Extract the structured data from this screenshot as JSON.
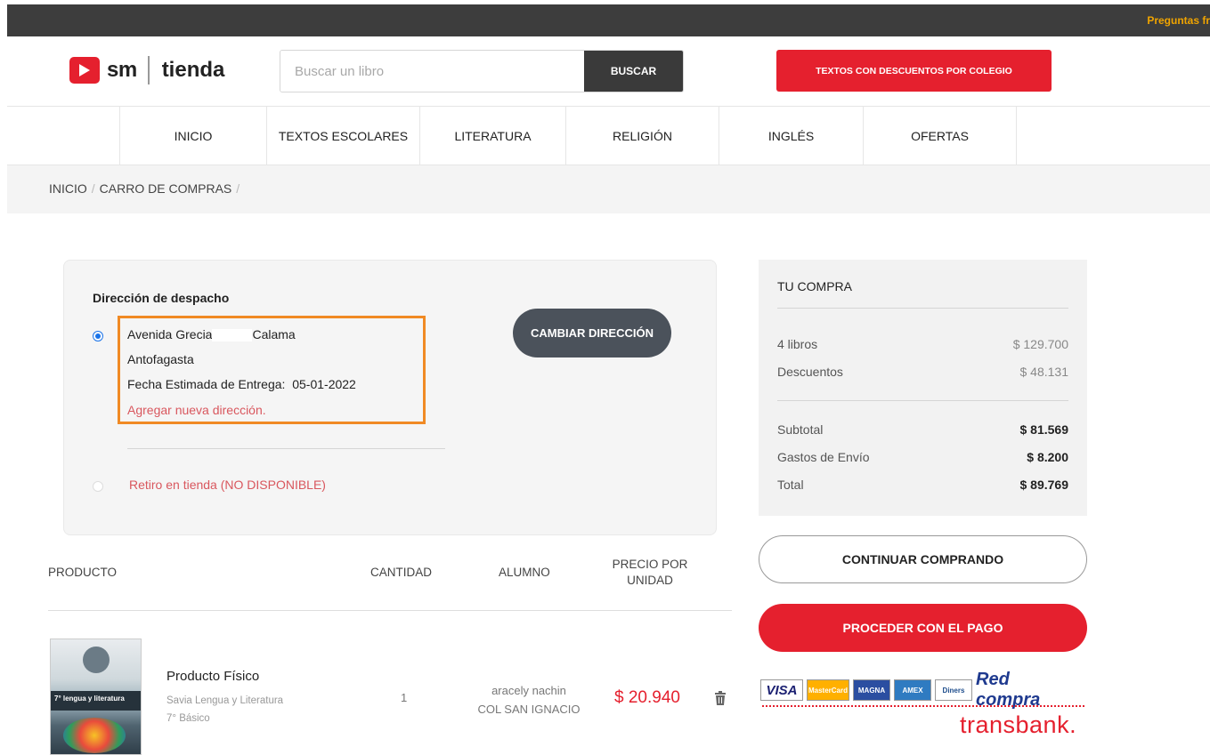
{
  "topbar": {
    "faq_text": "Preguntas fr"
  },
  "header": {
    "logo_sm": "sm",
    "logo_tienda": "tienda",
    "search_placeholder": "Buscar un libro",
    "search_button": "BUSCAR",
    "promo_button": "TEXTOS CON DESCUENTOS POR COLEGIO"
  },
  "nav": {
    "items": [
      "INICIO",
      "TEXTOS ESCOLARES",
      "LITERATURA",
      "RELIGIÓN",
      "INGLÉS",
      "OFERTAS"
    ]
  },
  "breadcrumb": [
    "INICIO",
    "CARRO DE COMPRAS"
  ],
  "shipping": {
    "title": "Dirección de despacho",
    "address_street": "Avenida Grecia",
    "address_city": "Calama",
    "address_region": "Antofagasta",
    "delivery_label": "Fecha Estimada de Entrega:",
    "delivery_date": "05-01-2022",
    "add_address_link": "Agregar nueva dirección.",
    "change_button": "CAMBIAR DIRECCIÓN",
    "pickup_option": "Retiro en tienda (NO DISPONIBLE)"
  },
  "table": {
    "headers": {
      "product": "PRODUCTO",
      "quantity": "CANTIDAD",
      "student": "ALUMNO",
      "unit_price_line1": "PRECIO POR",
      "unit_price_line2": "UNIDAD"
    },
    "rows": [
      {
        "type": "Producto Físico",
        "name": "Savia Lengua y Literatura",
        "grade": "7° Básico",
        "quantity": "1",
        "student_name": "aracely nachin",
        "school": "COL SAN IGNACIO",
        "price": "$ 20.940",
        "cover_text": "7° lengua y literatura"
      }
    ]
  },
  "summary": {
    "title": "TU COMPRA",
    "books_label": "4 libros",
    "books_value": "$ 129.700",
    "discount_label": "Descuentos",
    "discount_value": "$ 48.131",
    "subtotal_label": "Subtotal",
    "subtotal_value": "$ 81.569",
    "shipping_label": "Gastos de Envío",
    "shipping_value": "$ 8.200",
    "total_label": "Total",
    "total_value": "$ 89.769",
    "continue_button": "CONTINUAR COMPRANDO",
    "pay_button": "PROCEDER CON EL PAGO"
  },
  "payment": {
    "visa": "VISA",
    "mastercard": "MasterCard",
    "magna": "MAGNA",
    "amex": "AMEX",
    "diners": "Diners",
    "redcompra": "Red compra",
    "transbank": "transbank."
  },
  "colors": {
    "brand_red": "#e5202e",
    "dark": "#3a3a3a",
    "highlight_orange": "#f08a24",
    "link_red": "#d9575e"
  }
}
